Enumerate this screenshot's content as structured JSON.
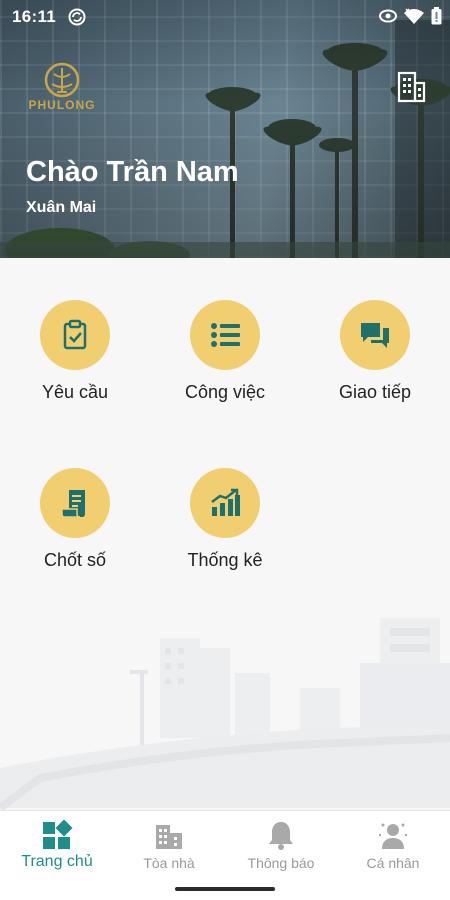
{
  "status_bar": {
    "time": "16:11"
  },
  "header": {
    "logo_text": "PHULONG",
    "greeting": "Chào Trần Nam",
    "location": "Xuân Mai"
  },
  "menu": [
    {
      "label": "Yêu cầu",
      "icon": "clipboard-check-icon"
    },
    {
      "label": "Công việc",
      "icon": "task-list-icon"
    },
    {
      "label": "Giao tiếp",
      "icon": "chat-icon"
    },
    {
      "label": "Chốt số",
      "icon": "meter-reading-icon"
    },
    {
      "label": "Thống kê",
      "icon": "statistics-icon"
    }
  ],
  "bottom_nav": [
    {
      "label": "Trang chủ",
      "icon": "dashboard-icon",
      "active": true
    },
    {
      "label": "Tòa nhà",
      "icon": "building-icon",
      "active": false
    },
    {
      "label": "Thông báo",
      "icon": "bell-icon",
      "active": false
    },
    {
      "label": "Cá nhân",
      "icon": "person-icon",
      "active": false
    }
  ],
  "colors": {
    "accent": "#1f8d8a",
    "menu_circle": "#f1cf70",
    "brand_gold": "#c9a648",
    "inactive": "#9a9a9a"
  }
}
